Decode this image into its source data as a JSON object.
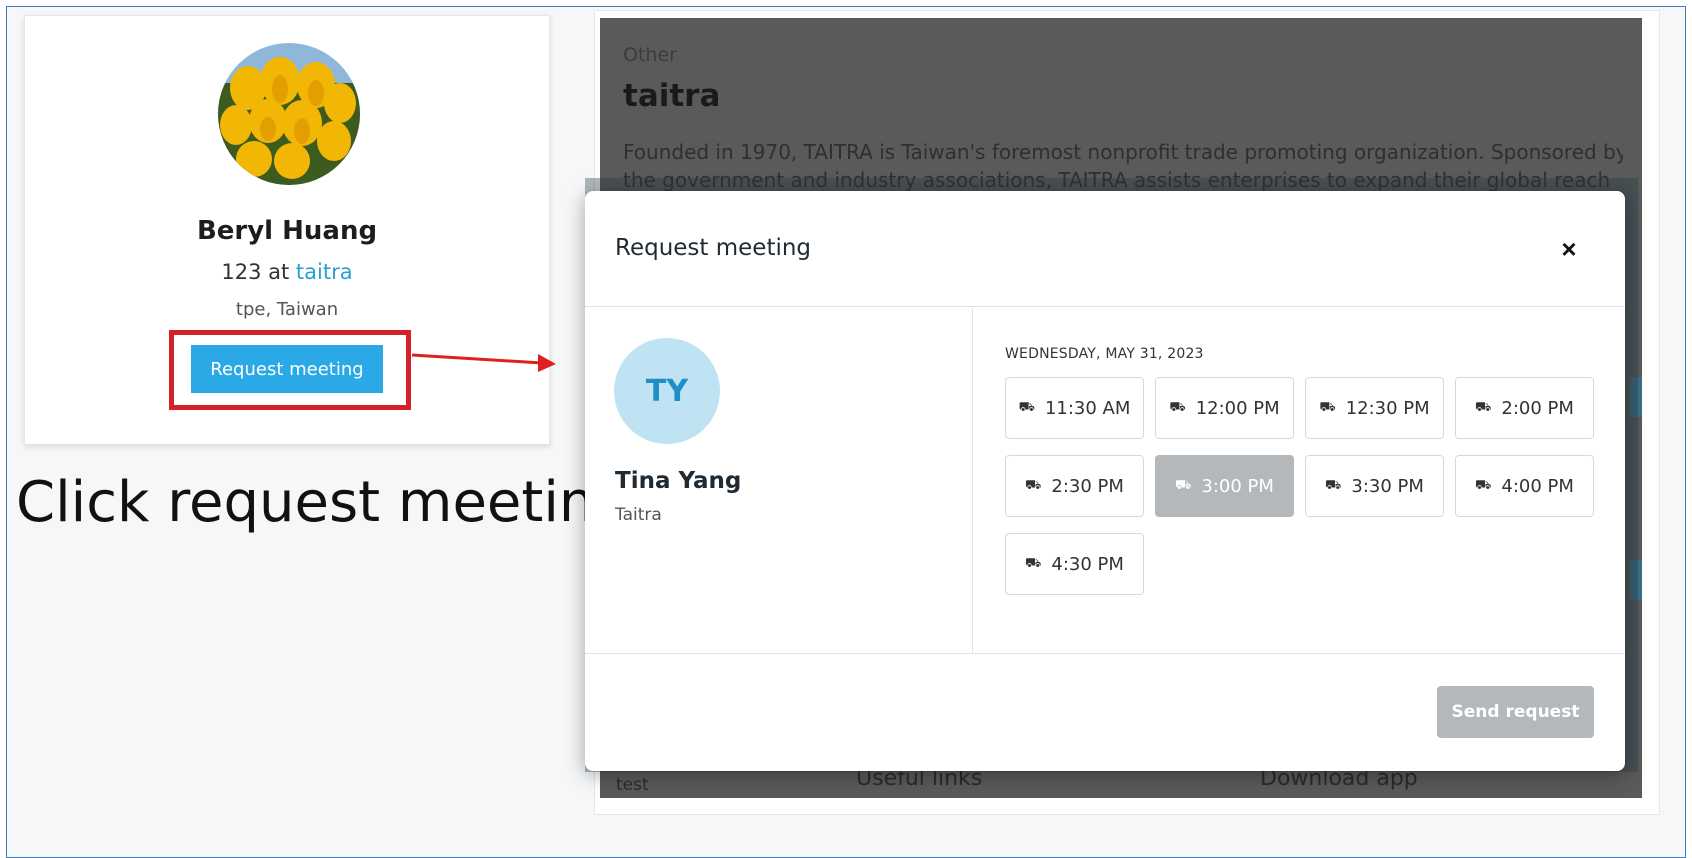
{
  "profile": {
    "name": "Beryl Huang",
    "role_prefix": "123 at ",
    "role_org": "taitra",
    "location": "tpe, Taiwan",
    "request_button": "Request meeting"
  },
  "caption": "Click request meeting",
  "background_page": {
    "category": "Other",
    "title": "taitra",
    "description_line1": "Founded in 1970, TAITRA is Taiwan's foremost nonprofit trade promoting organization. Sponsored by",
    "description_line2": "the government and industry associations, TAITRA assists enterprises to expand their global reach",
    "footer_text": "test",
    "footer_links": "Useful links",
    "footer_app": "Download app"
  },
  "modal": {
    "title": "Request meeting",
    "close_symbol": "×",
    "contact": {
      "initials": "TY",
      "name": "Tina Yang",
      "organization": "Taitra"
    },
    "date_label": "WEDNESDAY, MAY 31, 2023",
    "slots": [
      {
        "time": "11:30 AM",
        "selected": false
      },
      {
        "time": "12:00 PM",
        "selected": false
      },
      {
        "time": "12:30 PM",
        "selected": false
      },
      {
        "time": "2:00 PM",
        "selected": false
      },
      {
        "time": "2:30 PM",
        "selected": false
      },
      {
        "time": "3:00 PM",
        "selected": true
      },
      {
        "time": "3:30 PM",
        "selected": false
      },
      {
        "time": "4:00 PM",
        "selected": false
      },
      {
        "time": "4:30 PM",
        "selected": false
      }
    ],
    "send_button": "Send request"
  },
  "colors": {
    "accent": "#2aa9e6",
    "highlight": "#d4202a",
    "selected_slot": "#b4b8bb",
    "initials_bg": "#bfe3f3"
  }
}
